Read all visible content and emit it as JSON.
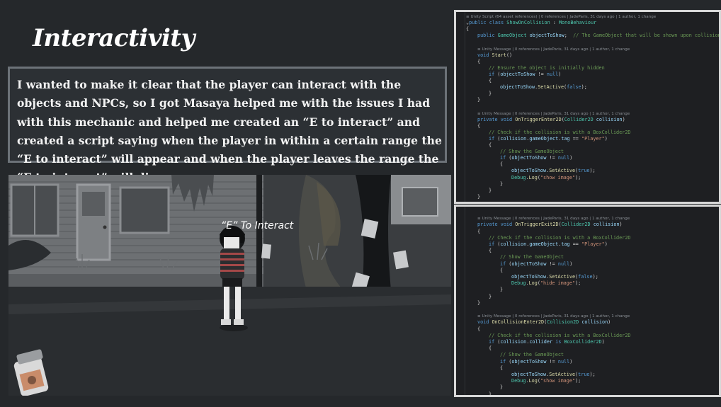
{
  "slide": {
    "title": "Interactivity",
    "description": "I wanted to make it clear that the player can interact with the objects and NPCs, so I got Masaya helped me with the issues I had with this mechanic and helped me created an “E to interact” and created a script saying when the player in within a certain range the “E to interact” will appear and when the player leaves the range the “E to interact” will disappear."
  },
  "game": {
    "prompt_text": "“E” To Interact",
    "label_text": ""
  },
  "colors": {
    "background": "#25282b",
    "keyword": "#569cd6",
    "type": "#4ec9b0",
    "function": "#dcdcaa",
    "variable": "#9cdcfe",
    "string": "#ce9178",
    "comment": "#6a9955"
  },
  "code_top": [
    {
      "indent": 0,
      "tokens": [
        [
          "meta",
          "≡ Unity Script (64 asset references) | 0 references | JadeParis, 31 days ago | 1 author, 1 change"
        ]
      ]
    },
    {
      "indent": 0,
      "tokens": [
        [
          "p",
          "⌄"
        ],
        [
          "kw",
          "public class "
        ],
        [
          "type",
          "ShowOnCollision"
        ],
        [
          "p",
          " : "
        ],
        [
          "type",
          "MonoBehaviour"
        ]
      ]
    },
    {
      "indent": 0,
      "tokens": [
        [
          "p",
          "{"
        ]
      ]
    },
    {
      "indent": 1,
      "tokens": [
        [
          "kw",
          "public "
        ],
        [
          "type",
          "GameObject "
        ],
        [
          "var",
          "objectToShow"
        ],
        [
          "p",
          ";  "
        ],
        [
          "cm",
          "// The GameObject that will be shown upon collision"
        ]
      ]
    },
    {
      "indent": 0,
      "tokens": []
    },
    {
      "indent": 1,
      "tokens": [
        [
          "meta",
          "≡ Unity Message | 0 references | JadeParis, 31 days ago | 1 author, 1 change"
        ]
      ]
    },
    {
      "indent": 1,
      "tokens": [
        [
          "kw",
          "void "
        ],
        [
          "fn",
          "Start"
        ],
        [
          "p",
          "()"
        ]
      ]
    },
    {
      "indent": 1,
      "tokens": [
        [
          "p",
          "{"
        ]
      ]
    },
    {
      "indent": 2,
      "tokens": [
        [
          "cm",
          "// Ensure the object is initially hidden"
        ]
      ]
    },
    {
      "indent": 2,
      "tokens": [
        [
          "kw",
          "if "
        ],
        [
          "p",
          "("
        ],
        [
          "var",
          "objectToShow"
        ],
        [
          "p",
          " != "
        ],
        [
          "kw",
          "null"
        ],
        [
          "p",
          ")"
        ]
      ]
    },
    {
      "indent": 2,
      "tokens": [
        [
          "p",
          "{"
        ]
      ]
    },
    {
      "indent": 3,
      "tokens": [
        [
          "var",
          "objectToShow"
        ],
        [
          "p",
          "."
        ],
        [
          "fn",
          "SetActive"
        ],
        [
          "p",
          "("
        ],
        [
          "kw",
          "false"
        ],
        [
          "p",
          ");"
        ]
      ]
    },
    {
      "indent": 2,
      "tokens": [
        [
          "p",
          "}"
        ]
      ]
    },
    {
      "indent": 1,
      "tokens": [
        [
          "p",
          "}"
        ]
      ]
    },
    {
      "indent": 0,
      "tokens": []
    },
    {
      "indent": 1,
      "tokens": [
        [
          "meta",
          "≡ Unity Message | 0 references | JadeParis, 31 days ago | 1 author, 1 change"
        ]
      ]
    },
    {
      "indent": 1,
      "tokens": [
        [
          "kw",
          "private void "
        ],
        [
          "fn",
          "OnTriggerEnter2D"
        ],
        [
          "p",
          "("
        ],
        [
          "type",
          "Collider2D"
        ],
        [
          "var",
          " collision"
        ],
        [
          "p",
          ")"
        ]
      ]
    },
    {
      "indent": 1,
      "tokens": [
        [
          "p",
          "{"
        ]
      ]
    },
    {
      "indent": 2,
      "tokens": [
        [
          "cm",
          "// Check if the collision is with a BoxCollider2D"
        ]
      ]
    },
    {
      "indent": 2,
      "tokens": [
        [
          "kw",
          "if "
        ],
        [
          "p",
          "("
        ],
        [
          "var",
          "collision"
        ],
        [
          "p",
          "."
        ],
        [
          "var",
          "gameObject"
        ],
        [
          "p",
          "."
        ],
        [
          "var",
          "tag"
        ],
        [
          "p",
          " == "
        ],
        [
          "str",
          "\"Player\""
        ],
        [
          "p",
          ")"
        ]
      ]
    },
    {
      "indent": 2,
      "tokens": [
        [
          "p",
          "{"
        ]
      ]
    },
    {
      "indent": 3,
      "tokens": [
        [
          "cm",
          "// Show the GameObject"
        ]
      ]
    },
    {
      "indent": 3,
      "tokens": [
        [
          "kw",
          "if "
        ],
        [
          "p",
          "("
        ],
        [
          "var",
          "objectToShow"
        ],
        [
          "p",
          " != "
        ],
        [
          "kw",
          "null"
        ],
        [
          "p",
          ")"
        ]
      ]
    },
    {
      "indent": 3,
      "tokens": [
        [
          "p",
          "{"
        ]
      ]
    },
    {
      "indent": 4,
      "tokens": [
        [
          "var",
          "objectToShow"
        ],
        [
          "p",
          "."
        ],
        [
          "fn",
          "SetActive"
        ],
        [
          "p",
          "("
        ],
        [
          "kw",
          "true"
        ],
        [
          "p",
          ");"
        ]
      ]
    },
    {
      "indent": 4,
      "tokens": [
        [
          "type",
          "Debug"
        ],
        [
          "p",
          "."
        ],
        [
          "fn",
          "Log"
        ],
        [
          "p",
          "("
        ],
        [
          "str",
          "\"show image\""
        ],
        [
          "p",
          ");"
        ]
      ]
    },
    {
      "indent": 3,
      "tokens": [
        [
          "p",
          "}"
        ]
      ]
    },
    {
      "indent": 2,
      "tokens": [
        [
          "p",
          "}"
        ]
      ]
    },
    {
      "indent": 1,
      "tokens": [
        [
          "p",
          "}"
        ]
      ]
    }
  ],
  "code_bottom": [
    {
      "indent": 0,
      "tokens": []
    },
    {
      "indent": 1,
      "tokens": [
        [
          "meta",
          "≡ Unity Message | 0 references | JadeParis, 31 days ago | 1 author, 1 change"
        ]
      ]
    },
    {
      "indent": 1,
      "tokens": [
        [
          "kw",
          "private void "
        ],
        [
          "fn",
          "OnTriggerExit2D"
        ],
        [
          "p",
          "("
        ],
        [
          "type",
          "Collider2D"
        ],
        [
          "var",
          " collision"
        ],
        [
          "p",
          ")"
        ]
      ]
    },
    {
      "indent": 1,
      "tokens": [
        [
          "p",
          "{"
        ]
      ]
    },
    {
      "indent": 2,
      "tokens": [
        [
          "cm",
          "// Check if the collision is with a BoxCollider2D"
        ]
      ]
    },
    {
      "indent": 2,
      "tokens": [
        [
          "kw",
          "if "
        ],
        [
          "p",
          "("
        ],
        [
          "var",
          "collision"
        ],
        [
          "p",
          "."
        ],
        [
          "var",
          "gameObject"
        ],
        [
          "p",
          "."
        ],
        [
          "var",
          "tag"
        ],
        [
          "p",
          " == "
        ],
        [
          "str",
          "\"Player\""
        ],
        [
          "p",
          ")"
        ]
      ]
    },
    {
      "indent": 2,
      "tokens": [
        [
          "p",
          "{"
        ]
      ]
    },
    {
      "indent": 3,
      "tokens": [
        [
          "cm",
          "// Show the GameObject"
        ]
      ]
    },
    {
      "indent": 3,
      "tokens": [
        [
          "kw",
          "if "
        ],
        [
          "p",
          "("
        ],
        [
          "var",
          "objectToShow"
        ],
        [
          "p",
          " != "
        ],
        [
          "kw",
          "null"
        ],
        [
          "p",
          ")"
        ]
      ]
    },
    {
      "indent": 3,
      "tokens": [
        [
          "p",
          "{"
        ]
      ]
    },
    {
      "indent": 4,
      "tokens": [
        [
          "var",
          "objectToShow"
        ],
        [
          "p",
          "."
        ],
        [
          "fn",
          "SetActive"
        ],
        [
          "p",
          "("
        ],
        [
          "kw",
          "false"
        ],
        [
          "p",
          ");"
        ]
      ]
    },
    {
      "indent": 4,
      "tokens": [
        [
          "type",
          "Debug"
        ],
        [
          "p",
          "."
        ],
        [
          "fn",
          "Log"
        ],
        [
          "p",
          "("
        ],
        [
          "str",
          "\"hide image\""
        ],
        [
          "p",
          ");"
        ]
      ]
    },
    {
      "indent": 3,
      "tokens": [
        [
          "p",
          "}"
        ]
      ]
    },
    {
      "indent": 2,
      "tokens": [
        [
          "p",
          "}"
        ]
      ]
    },
    {
      "indent": 1,
      "tokens": [
        [
          "p",
          "}"
        ]
      ]
    },
    {
      "indent": 0,
      "tokens": []
    },
    {
      "indent": 1,
      "tokens": [
        [
          "meta",
          "≡ Unity Message | 0 references | JadeParis, 31 days ago | 1 author, 1 change"
        ]
      ]
    },
    {
      "indent": 1,
      "tokens": [
        [
          "kw",
          "void "
        ],
        [
          "fn",
          "OnCollisionEnter2D"
        ],
        [
          "p",
          "("
        ],
        [
          "type",
          "Collision2D"
        ],
        [
          "var",
          " collision"
        ],
        [
          "p",
          ")"
        ]
      ]
    },
    {
      "indent": 1,
      "tokens": [
        [
          "p",
          "{"
        ]
      ]
    },
    {
      "indent": 2,
      "tokens": [
        [
          "cm",
          "// Check if the collision is with a BoxCollider2D"
        ]
      ]
    },
    {
      "indent": 2,
      "tokens": [
        [
          "kw",
          "if "
        ],
        [
          "p",
          "("
        ],
        [
          "var",
          "collision"
        ],
        [
          "p",
          "."
        ],
        [
          "var",
          "collider"
        ],
        [
          "kw",
          " is "
        ],
        [
          "type",
          "BoxCollider2D"
        ],
        [
          "p",
          ")"
        ]
      ]
    },
    {
      "indent": 2,
      "tokens": [
        [
          "p",
          "{"
        ]
      ]
    },
    {
      "indent": 3,
      "tokens": [
        [
          "cm",
          "// Show the GameObject"
        ]
      ]
    },
    {
      "indent": 3,
      "tokens": [
        [
          "kw",
          "if "
        ],
        [
          "p",
          "("
        ],
        [
          "var",
          "objectToShow"
        ],
        [
          "p",
          " != "
        ],
        [
          "kw",
          "null"
        ],
        [
          "p",
          ")"
        ]
      ]
    },
    {
      "indent": 3,
      "tokens": [
        [
          "p",
          "{"
        ]
      ]
    },
    {
      "indent": 4,
      "tokens": [
        [
          "var",
          "objectToShow"
        ],
        [
          "p",
          "."
        ],
        [
          "fn",
          "SetActive"
        ],
        [
          "p",
          "("
        ],
        [
          "kw",
          "true"
        ],
        [
          "p",
          ");"
        ]
      ]
    },
    {
      "indent": 4,
      "tokens": [
        [
          "type",
          "Debug"
        ],
        [
          "p",
          "."
        ],
        [
          "fn",
          "Log"
        ],
        [
          "p",
          "("
        ],
        [
          "str",
          "\"show image\""
        ],
        [
          "p",
          ");"
        ]
      ]
    },
    {
      "indent": 3,
      "tokens": [
        [
          "p",
          "}"
        ]
      ]
    },
    {
      "indent": 2,
      "tokens": [
        [
          "p",
          "}"
        ]
      ]
    }
  ]
}
